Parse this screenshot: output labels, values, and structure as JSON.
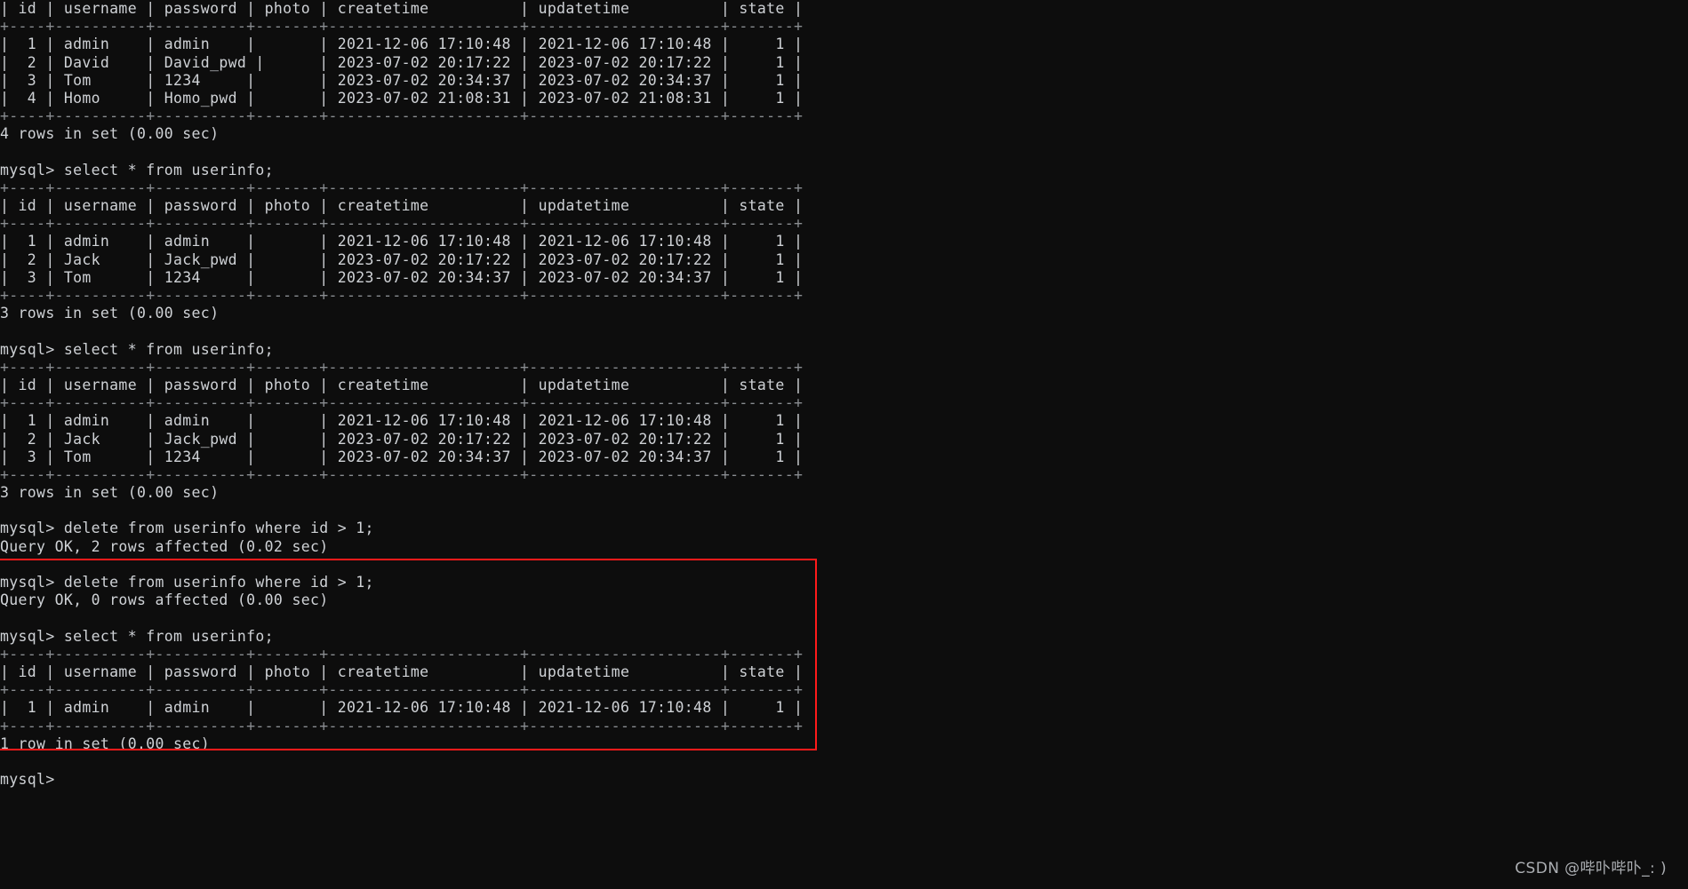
{
  "terminal": {
    "background_color": "#0d0d0d",
    "text_color": "#cfd2d6",
    "rule_color": "#8a8d91",
    "prompt": "mysql>",
    "lines": [
      "| id | username | password | photo | createtime          | updatetime          | state |",
      "+----+----------+----------+-------+---------------------+---------------------+-------+",
      "|  1 | admin    | admin    |       | 2021-12-06 17:10:48 | 2021-12-06 17:10:48 |     1 |",
      "|  2 | David    | David_pwd |      | 2023-07-02 20:17:22 | 2023-07-02 20:17:22 |     1 |",
      "|  3 | Tom      | 1234     |       | 2023-07-02 20:34:37 | 2023-07-02 20:34:37 |     1 |",
      "|  4 | Homo     | Homo_pwd |       | 2023-07-02 21:08:31 | 2023-07-02 21:08:31 |     1 |",
      "+----+----------+----------+-------+---------------------+---------------------+-------+",
      "4 rows in set (0.00 sec)",
      "",
      "mysql> select * from userinfo;",
      "+----+----------+----------+-------+---------------------+---------------------+-------+",
      "| id | username | password | photo | createtime          | updatetime          | state |",
      "+----+----------+----------+-------+---------------------+---------------------+-------+",
      "|  1 | admin    | admin    |       | 2021-12-06 17:10:48 | 2021-12-06 17:10:48 |     1 |",
      "|  2 | Jack     | Jack_pwd |       | 2023-07-02 20:17:22 | 2023-07-02 20:17:22 |     1 |",
      "|  3 | Tom      | 1234     |       | 2023-07-02 20:34:37 | 2023-07-02 20:34:37 |     1 |",
      "+----+----------+----------+-------+---------------------+---------------------+-------+",
      "3 rows in set (0.00 sec)",
      "",
      "mysql> select * from userinfo;",
      "+----+----------+----------+-------+---------------------+---------------------+-------+",
      "| id | username | password | photo | createtime          | updatetime          | state |",
      "+----+----------+----------+-------+---------------------+---------------------+-------+",
      "|  1 | admin    | admin    |       | 2021-12-06 17:10:48 | 2021-12-06 17:10:48 |     1 |",
      "|  2 | Jack     | Jack_pwd |       | 2023-07-02 20:17:22 | 2023-07-02 20:17:22 |     1 |",
      "|  3 | Tom      | 1234     |       | 2023-07-02 20:34:37 | 2023-07-02 20:34:37 |     1 |",
      "+----+----------+----------+-------+---------------------+---------------------+-------+",
      "3 rows in set (0.00 sec)",
      "",
      "mysql> delete from userinfo where id > 1;",
      "Query OK, 2 rows affected (0.02 sec)",
      "",
      "mysql> delete from userinfo where id > 1;",
      "Query OK, 0 rows affected (0.00 sec)",
      "",
      "mysql> select * from userinfo;",
      "+----+----------+----------+-------+---------------------+---------------------+-------+",
      "| id | username | password | photo | createtime          | updatetime          | state |",
      "+----+----------+----------+-------+---------------------+---------------------+-------+",
      "|  1 | admin    | admin    |       | 2021-12-06 17:10:48 | 2021-12-06 17:10:48 |     1 |",
      "+----+----------+----------+-------+---------------------+---------------------+-------+",
      "1 row in set (0.00 sec)",
      "",
      "mysql>"
    ],
    "queries": [
      "select * from userinfo;",
      "select * from userinfo;",
      "delete from userinfo where id > 1;",
      "delete from userinfo where id > 1;",
      "select * from userinfo;"
    ],
    "status_messages": [
      "4 rows in set (0.00 sec)",
      "3 rows in set (0.00 sec)",
      "3 rows in set (0.00 sec)",
      "Query OK, 2 rows affected (0.02 sec)",
      "Query OK, 0 rows affected (0.00 sec)",
      "1 row in set (0.00 sec)"
    ],
    "table_columns": [
      "id",
      "username",
      "password",
      "photo",
      "createtime",
      "updatetime",
      "state"
    ],
    "result_sets": [
      {
        "rows": [
          [
            "1",
            "admin",
            "admin",
            "",
            "2021-12-06 17:10:48",
            "2021-12-06 17:10:48",
            "1"
          ],
          [
            "2",
            "David",
            "David_pwd",
            "",
            "2023-07-02 20:17:22",
            "2023-07-02 20:17:22",
            "1"
          ],
          [
            "3",
            "Tom",
            "1234",
            "",
            "2023-07-02 20:34:37",
            "2023-07-02 20:34:37",
            "1"
          ],
          [
            "4",
            "Homo",
            "Homo_pwd",
            "",
            "2023-07-02 21:08:31",
            "2023-07-02 21:08:31",
            "1"
          ]
        ],
        "footer": "4 rows in set (0.00 sec)"
      },
      {
        "rows": [
          [
            "1",
            "admin",
            "admin",
            "",
            "2021-12-06 17:10:48",
            "2021-12-06 17:10:48",
            "1"
          ],
          [
            "2",
            "Jack",
            "Jack_pwd",
            "",
            "2023-07-02 20:17:22",
            "2023-07-02 20:17:22",
            "1"
          ],
          [
            "3",
            "Tom",
            "1234",
            "",
            "2023-07-02 20:34:37",
            "2023-07-02 20:34:37",
            "1"
          ]
        ],
        "footer": "3 rows in set (0.00 sec)"
      },
      {
        "rows": [
          [
            "1",
            "admin",
            "admin",
            "",
            "2021-12-06 17:10:48",
            "2021-12-06 17:10:48",
            "1"
          ],
          [
            "2",
            "Jack",
            "Jack_pwd",
            "",
            "2023-07-02 20:17:22",
            "2023-07-02 20:17:22",
            "1"
          ],
          [
            "3",
            "Tom",
            "1234",
            "",
            "2023-07-02 20:34:37",
            "2023-07-02 20:34:37",
            "1"
          ]
        ],
        "footer": "3 rows in set (0.00 sec)"
      },
      {
        "rows": [
          [
            "1",
            "admin",
            "admin",
            "",
            "2021-12-06 17:10:48",
            "2021-12-06 17:10:48",
            "1"
          ]
        ],
        "footer": "1 row in set (0.00 sec)"
      }
    ]
  },
  "annotation": {
    "color": "#ff1a1a",
    "label": ""
  },
  "watermark": {
    "text": "CSDN @哔卟哔卟_: )",
    "color": "#b9bcc0"
  }
}
